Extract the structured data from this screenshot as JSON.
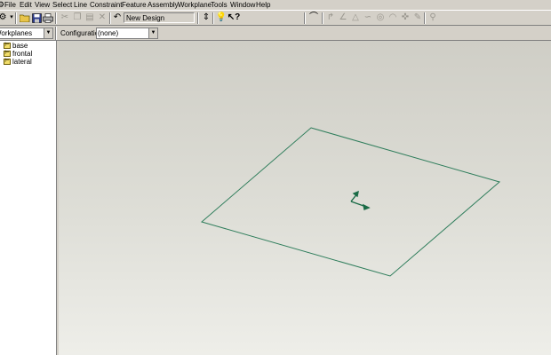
{
  "menu": {
    "items": [
      "File",
      "Edit",
      "View",
      "Select",
      "Line",
      "Constraint",
      "Feature",
      "Assembly",
      "Workplane",
      "Tools",
      "Window",
      "Help"
    ]
  },
  "toolbar": {
    "design_name": "New Design",
    "icons": [
      "settings-icon",
      "dropdown-arrow-icon",
      "open-folder-icon",
      "save-icon",
      "print-icon",
      "cut-icon",
      "copy-icon",
      "paste-icon",
      "delete-icon",
      "undo-icon",
      "level-icon",
      "bulb-icon",
      "help-pointer-icon",
      "redraw-icon",
      "line-tool-icon",
      "angle-tool-icon",
      "triangle-tool-icon",
      "curve-tool-icon",
      "circle-tool-icon",
      "arc-tool-icon",
      "point-tool-icon",
      "pen-tool-icon",
      "zoom-icon"
    ]
  },
  "selector": {
    "workplanes_value": "Workplanes",
    "configuration_label": "Configuration:",
    "configuration_value": "(none)"
  },
  "tree": {
    "items": [
      {
        "label": "base"
      },
      {
        "label": "frontal"
      },
      {
        "label": "lateral"
      }
    ]
  },
  "colors": {
    "workplane_outline": "#2e7d5b",
    "axis": "#1a6b46",
    "chrome": "#d4d0c8"
  }
}
